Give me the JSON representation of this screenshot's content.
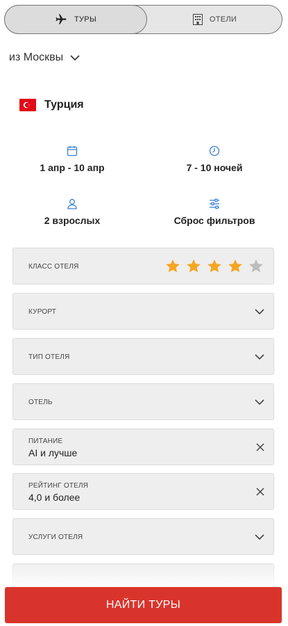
{
  "tabs": {
    "tours_label": "ТУРЫ",
    "hotels_label": "ОТЕЛИ",
    "active": "tours"
  },
  "origin": {
    "label": "из Москвы"
  },
  "destination": {
    "country": "Турция",
    "flag_color": "#e30a17"
  },
  "params": {
    "dates": "1 апр - 10 апр",
    "nights": "7 - 10 ночей",
    "guests": "2 взрослых",
    "reset": "Сброс фильтров"
  },
  "filters": {
    "hotel_class": {
      "label": "класс отеля",
      "stars_filled": 4,
      "stars_total": 5
    },
    "resort": {
      "label": "курорт"
    },
    "hotel_type": {
      "label": "тип отеля"
    },
    "hotel": {
      "label": "отель"
    },
    "meal": {
      "label": "питание",
      "value": "AI и лучше"
    },
    "rating": {
      "label": "рейтинг отеля",
      "value": "4,0 и более"
    },
    "services": {
      "label": "услуги отеля"
    }
  },
  "cta": {
    "label": "НАЙТИ ТУРЫ"
  },
  "colors": {
    "accent": "#d9342b",
    "star_on": "#f5a623",
    "star_off": "#bdbdbd",
    "icon_blue": "#3b7fd1"
  }
}
